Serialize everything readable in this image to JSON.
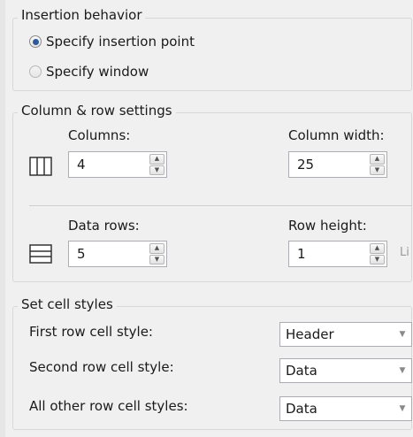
{
  "insertion": {
    "title": "Insertion behavior",
    "option_point": "Specify insertion point",
    "option_window": "Specify window"
  },
  "colrow": {
    "title": "Column & row settings",
    "columns_label": "Columns:",
    "columns_value": "4",
    "column_width_label": "Column width:",
    "column_width_value": "25",
    "data_rows_label": "Data rows:",
    "data_rows_value": "5",
    "row_height_label": "Row height:",
    "row_height_value": "1",
    "row_height_unit": "Li"
  },
  "cellstyles": {
    "title": "Set cell styles",
    "first_label": "First row cell style:",
    "first_value": "Header",
    "second_label": "Second row cell style:",
    "second_value": "Data",
    "other_label": "All other row cell styles:",
    "other_value": "Data"
  },
  "icons": {
    "columns": "columns-icon",
    "rows": "rows-icon",
    "spin_up": "spin-up-icon",
    "spin_down": "spin-down-icon",
    "dropdown": "chevron-down-icon"
  }
}
